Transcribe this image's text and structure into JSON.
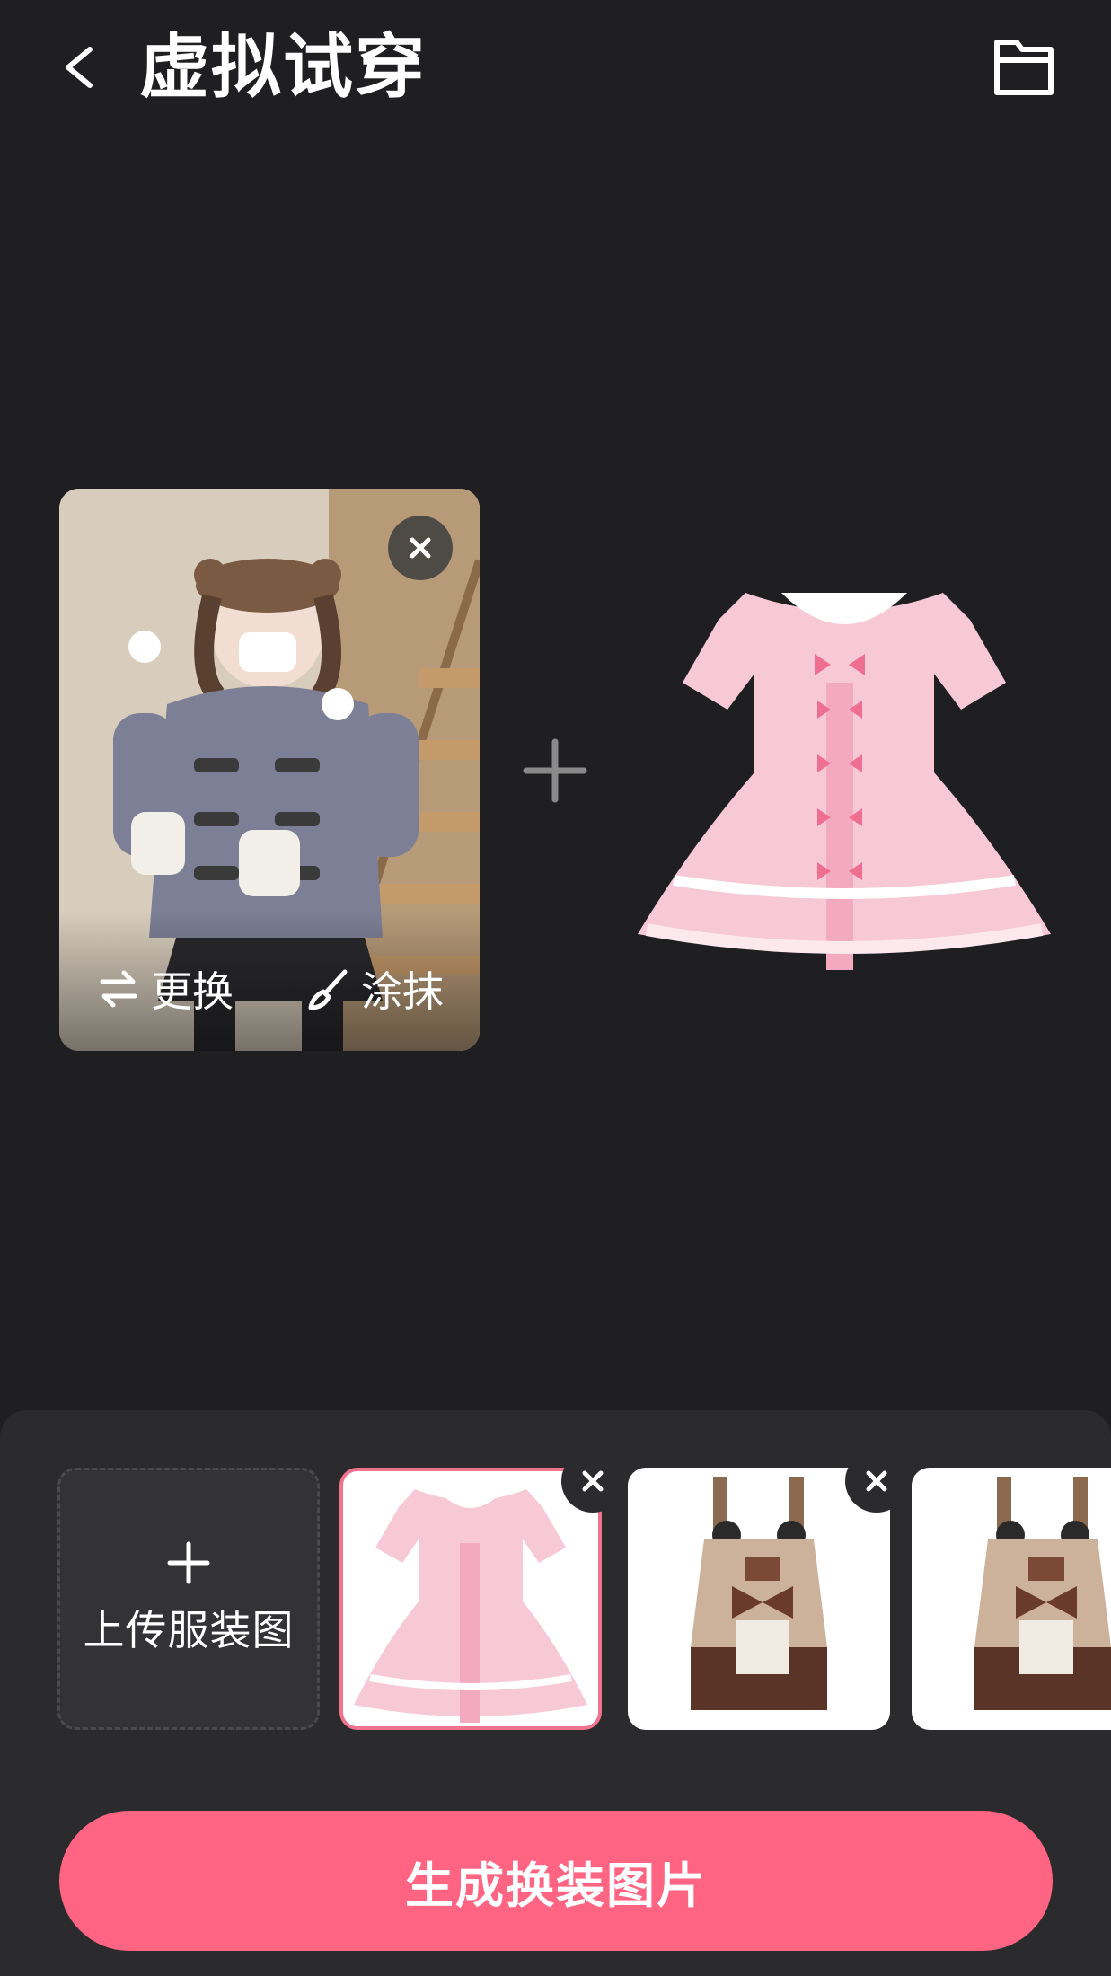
{
  "header": {
    "title": "虚拟试穿",
    "back_icon": "chevron-left-icon",
    "folder_icon": "folder-icon"
  },
  "model_card": {
    "replace_label": "更换",
    "paint_label": "涂抹",
    "replace_icon": "swap-arrows-icon",
    "paint_icon": "brush-icon",
    "remove_icon": "close-icon"
  },
  "garment_preview": {
    "icon": "plus-icon"
  },
  "bottom_panel": {
    "upload_label": "上传服装图",
    "thumbnails": [
      {
        "name": "pink-dress",
        "selected": true
      },
      {
        "name": "bear-overall-dress",
        "selected": false
      },
      {
        "name": "bear-overall-dress",
        "selected": false
      }
    ]
  },
  "generate_button": {
    "label": "生成换装图片"
  },
  "colors": {
    "background": "#1f1f21",
    "panel": "#2b2b2e",
    "accent": "#ff6482",
    "selected_border": "#f0738e"
  }
}
